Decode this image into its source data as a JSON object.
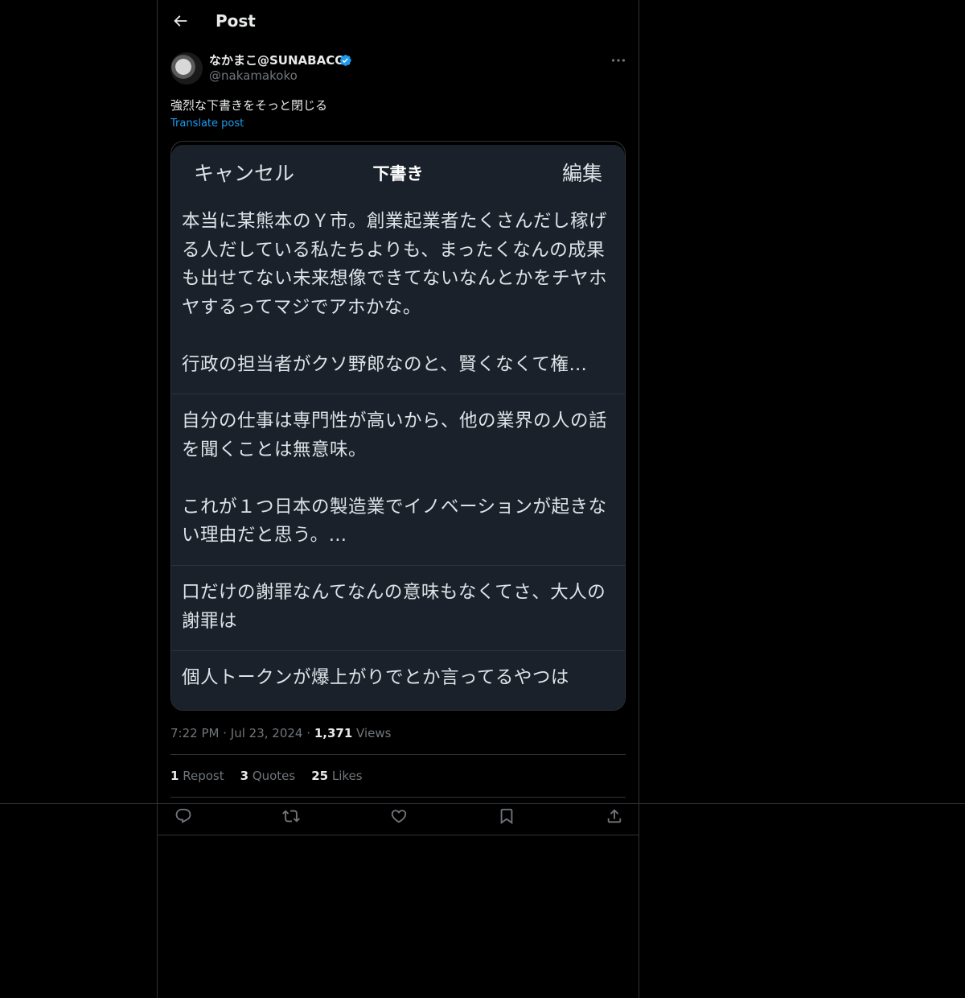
{
  "header": {
    "title": "Post"
  },
  "author": {
    "display_name": "なかまこ@SUNABACO",
    "handle": "@nakamakoko"
  },
  "post": {
    "text": "強烈な下書きをそっと閉じる",
    "translate_label": "Translate post"
  },
  "image": {
    "cancel_label": "キャンセル",
    "title": "下書き",
    "edit_label": "編集",
    "drafts": [
      {
        "text": "本当に某熊本のＹ市。創業起業者たくさんだし稼げる人だしている私たちよりも、まったくなんの成果も出せてない未来想像できてないなんとかをチヤホヤするってマジでアホかな。\n\n行政の担当者がクソ野郎なのと、賢くなくて権…"
      },
      {
        "text": "自分の仕事は専門性が高いから、他の業界の人の話を聞くことは無意味。\n\nこれが１つ日本の製造業でイノベーションが起きない理由だと思う。…"
      },
      {
        "text": "口だけの謝罪なんてなんの意味もなくてさ、大人の謝罪は"
      },
      {
        "text": "個人トークンが爆上がりでとか言ってるやつは"
      }
    ]
  },
  "meta": {
    "time": "7:22 PM",
    "date": "Jul 23, 2024",
    "views_count": "1,371",
    "views_label": "Views",
    "dot": "·"
  },
  "stats": {
    "reposts_count": "1",
    "reposts_label": "Repost",
    "quotes_count": "3",
    "quotes_label": "Quotes",
    "likes_count": "25",
    "likes_label": "Likes"
  },
  "icons": {
    "back": "arrow-left-icon",
    "verified": "verified-badge-icon",
    "more": "more-horizontal-icon",
    "reply": "reply-icon",
    "repost": "repost-icon",
    "like": "heart-icon",
    "bookmark": "bookmark-icon",
    "share": "share-icon"
  },
  "colors": {
    "background": "#000000",
    "accent": "#1d9bf0",
    "muted": "#71767b",
    "border": "#2f3336",
    "draft_panel": "#1a212a"
  }
}
